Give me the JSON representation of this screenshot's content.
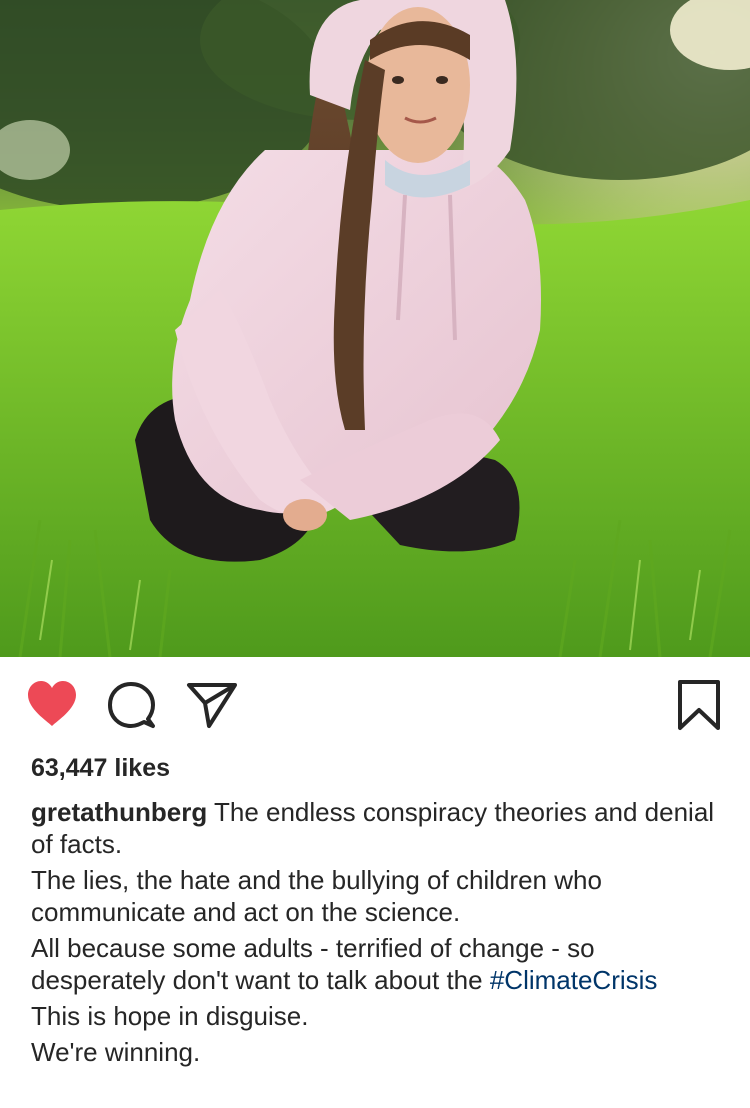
{
  "post": {
    "photo_alt": "",
    "actions": {
      "liked": true,
      "like_icon": "heart-filled-icon",
      "comment_icon": "comment-bubble-icon",
      "share_icon": "paper-plane-icon",
      "save_icon": "bookmark-icon",
      "like_color": "#ed4956"
    },
    "likes_text": "63,447 likes",
    "caption": {
      "username": "gretathunberg",
      "line1_text": " The endless conspiracy theories and denial of facts.",
      "line2_text": "The lies, the hate and the bullying of children who communicate and act on the science.",
      "line3_text": "All because some adults - terrified of change - so desperately don't want to talk about the ",
      "hashtag": "#ClimateCrisis",
      "line4_text": "This is hope in disguise.",
      "line5_text": "We're winning."
    }
  },
  "colors": {
    "text": "#262626",
    "hashtag": "#003569",
    "heart": "#ed4956"
  }
}
